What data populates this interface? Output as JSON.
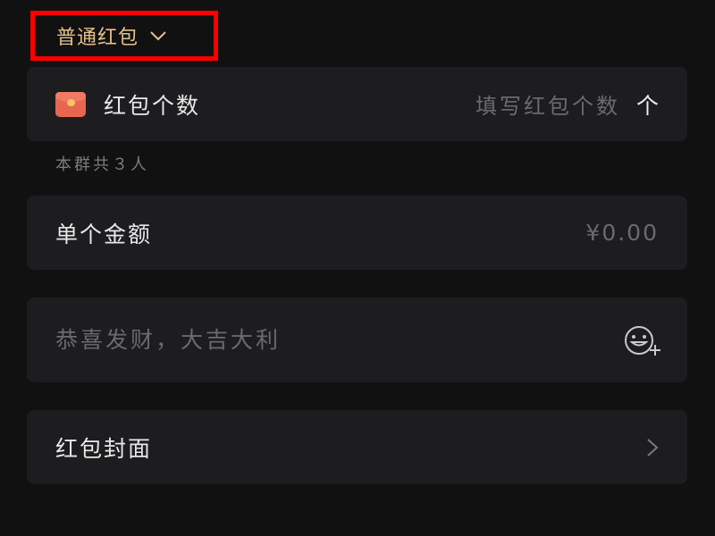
{
  "packet_type": {
    "label": "普通红包"
  },
  "count_row": {
    "label": "红包个数",
    "placeholder": "填写红包个数",
    "unit": "个"
  },
  "group_hint": "本群共３人",
  "amount_row": {
    "label": "单个金额",
    "value": "¥0.00"
  },
  "message_row": {
    "placeholder": "恭喜发财，大吉大利",
    "emoji_icon": "emoji-add-icon"
  },
  "cover_row": {
    "label": "红包封面",
    "chevron_icon": "chevron-right-icon"
  },
  "colors": {
    "background": "#111111",
    "card": "#1d1c1f",
    "accent_gold": "#e3c18d",
    "highlight_border": "#ff0000",
    "red_packet": "#e8664f"
  }
}
